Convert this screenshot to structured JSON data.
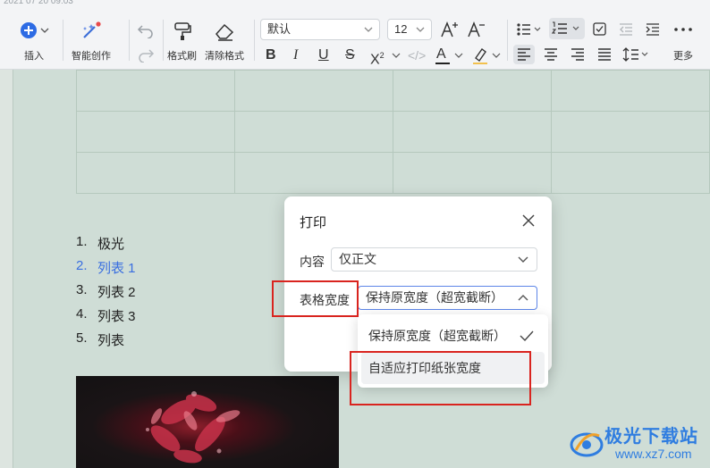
{
  "toolbar": {
    "top_strip_text": "2021 07 20 09:03",
    "insert_label": "插入",
    "ai_label": "智能创作",
    "format_painter_label": "格式刷",
    "clear_format_label": "清除格式",
    "font_name": "默认",
    "font_size": "12",
    "more_label": "更多",
    "accent_color": "#2d6be4",
    "ai_dot_color": "#e84a4a"
  },
  "document": {
    "list": [
      {
        "num": "1.",
        "text": "极光"
      },
      {
        "num": "2.",
        "text": "列表 1"
      },
      {
        "num": "3.",
        "text": "列表 2"
      },
      {
        "num": "4.",
        "text": "列表 3"
      },
      {
        "num": "5.",
        "text": "列表"
      }
    ]
  },
  "dialog": {
    "title": "打印",
    "content_label": "内容",
    "content_value": "仅正文",
    "table_width_label": "表格宽度",
    "table_width_value": "保持原宽度（超宽截断）",
    "options": [
      {
        "label": "保持原宽度（超宽截断）",
        "selected": true
      },
      {
        "label": "自适应打印纸张宽度",
        "selected": false
      }
    ]
  },
  "watermark": {
    "line1": "极光下载站",
    "line2": "www.xz7.com"
  },
  "colors": {
    "highlight_red": "#d9241f",
    "active_list_blue": "#3a6fe0",
    "page_bg": "#cfddd6"
  }
}
